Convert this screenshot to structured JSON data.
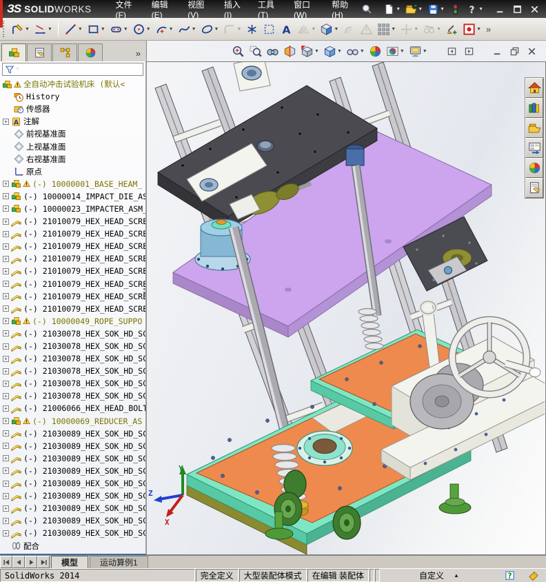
{
  "titlebar": {
    "logo": {
      "mark": "ЗS",
      "bold": "SOLID",
      "light": "WORKS"
    },
    "menus": [
      "文件(F)",
      "编辑(E)",
      "视图(V)",
      "插入(I)",
      "工具(T)",
      "窗口(W)",
      "帮助(H)"
    ],
    "search_icon": "search",
    "quick_access": [
      {
        "i": "new-document",
        "dd": 1
      },
      {
        "i": "open-folder",
        "dd": 1
      },
      {
        "i": "save",
        "dd": 1
      },
      {
        "i": "rebuild-lights"
      },
      {
        "i": "help",
        "dd": 1
      }
    ],
    "window_buttons": [
      {
        "i": "win-minimize"
      },
      {
        "i": "win-maximize"
      },
      {
        "i": "win-close"
      }
    ]
  },
  "sketch_toolbar": [
    {
      "i": "sketch",
      "dd": 1
    },
    {
      "i": "smart-dimension",
      "dd": 1
    },
    {
      "sep": 1
    },
    {
      "i": "line",
      "dd": 1
    },
    {
      "i": "rectangle",
      "dd": 1
    },
    {
      "i": "slot",
      "dd": 1
    },
    {
      "i": "circle",
      "dd": 1
    },
    {
      "i": "arc",
      "dd": 1
    },
    {
      "i": "spline",
      "dd": 1
    },
    {
      "i": "ellipse",
      "dd": 1
    },
    {
      "i": "fillet",
      "dd": 1,
      "dis": 1
    },
    {
      "i": "point"
    },
    {
      "i": "select-box"
    },
    {
      "i": "text-tool"
    },
    {
      "i": "mirror-entities",
      "dd": 1,
      "dis": 1
    },
    {
      "i": "convert-entities",
      "dd": 1
    },
    {
      "i": "offset-entities",
      "dis": 1
    },
    {
      "i": "sketch-warning",
      "dis": 1
    },
    {
      "i": "linear-pattern",
      "dd": 1
    },
    {
      "i": "move-entities",
      "dd": 1,
      "dis": 1
    },
    {
      "i": "display-relations",
      "dd": 1,
      "dis": 1
    },
    {
      "i": "quick-snaps"
    },
    {
      "i": "no-external-refs",
      "dd": 1
    },
    {
      "chev": 1
    }
  ],
  "manager_tabs": [
    {
      "i": "featuremanager",
      "active": 1
    },
    {
      "i": "propertymanager"
    },
    {
      "i": "configurationmanager"
    },
    {
      "i": "displaymanager"
    },
    {
      "chev": 1
    }
  ],
  "headsup_toolbar": [
    {
      "i": "zoom-fit"
    },
    {
      "i": "zoom-area"
    },
    {
      "i": "previous-view"
    },
    {
      "i": "section-view"
    },
    {
      "i": "view-orientation",
      "dd": 1
    },
    {
      "i": "display-style",
      "dd": 1
    },
    {
      "i": "hide-show-items",
      "dd": 1
    },
    {
      "i": "edit-appearance"
    },
    {
      "i": "apply-scene",
      "dd": 1
    },
    {
      "i": "view-settings",
      "dd": 1
    }
  ],
  "child_window_buttons": [
    {
      "i": "pane-left"
    },
    {
      "i": "pane-right"
    },
    {
      "gap": 1
    },
    {
      "i": "win-minimize"
    },
    {
      "i": "win-restore"
    },
    {
      "i": "win-close"
    }
  ],
  "feature_tree": {
    "filter_icon": "funnel",
    "rows": [
      {
        "icon": "assembly",
        "warn": true,
        "olive": true,
        "label": "全自动冲击试验机床 (默认<",
        "indent": 0
      },
      {
        "icon": "history",
        "label": "History",
        "indent": 1
      },
      {
        "icon": "sensors",
        "label": "传感器",
        "indent": 1
      },
      {
        "icon": "annotations",
        "label": "注解",
        "indent": 1,
        "plus": true
      },
      {
        "icon": "plane",
        "label": "前视基准面",
        "indent": 1
      },
      {
        "icon": "plane",
        "label": "上视基准面",
        "indent": 1
      },
      {
        "icon": "plane",
        "label": "右视基准面",
        "indent": 1
      },
      {
        "icon": "origin",
        "label": "原点",
        "indent": 1
      },
      {
        "icon": "assembly",
        "warn": true,
        "olive": true,
        "plus": true,
        "label": "(-) 10000001_BASE_HEAM_"
      },
      {
        "icon": "assembly",
        "plus": true,
        "label": "(-) 10000014_IMPACT_DIE_AS"
      },
      {
        "icon": "assembly",
        "plus": true,
        "label": "(-) 10000023_IMPACTER_ASM_"
      },
      {
        "icon": "part",
        "plus": true,
        "label": "(-) 21010079_HEX_HEAD_SCRE"
      },
      {
        "icon": "part",
        "plus": true,
        "label": "(-) 21010079_HEX_HEAD_SCRE"
      },
      {
        "icon": "part",
        "plus": true,
        "label": "(-) 21010079_HEX_HEAD_SCRE"
      },
      {
        "icon": "part",
        "plus": true,
        "label": "(-) 21010079_HEX_HEAD_SCRE"
      },
      {
        "icon": "part",
        "plus": true,
        "label": "(-) 21010079_HEX_HEAD_SCRE"
      },
      {
        "icon": "part",
        "plus": true,
        "label": "(-) 21010079_HEX_HEAD_SCRE"
      },
      {
        "icon": "part",
        "plus": true,
        "label": "(-) 21010079_HEX_HEAD_SCRE"
      },
      {
        "icon": "part",
        "plus": true,
        "label": "(-) 21010079_HEX_HEAD_SCRE"
      },
      {
        "icon": "assembly",
        "warn": true,
        "olive": true,
        "plus": true,
        "label": "(-) 10000049_ROPE_SUPPO"
      },
      {
        "icon": "part",
        "plus": true,
        "label": "(-) 21030078_HEX_SOK_HD_SC"
      },
      {
        "icon": "part",
        "plus": true,
        "label": "(-) 21030078_HEX_SOK_HD_SC"
      },
      {
        "icon": "part",
        "plus": true,
        "label": "(-) 21030078_HEX_SOK_HD_SC"
      },
      {
        "icon": "part",
        "plus": true,
        "label": "(-) 21030078_HEX_SOK_HD_SC"
      },
      {
        "icon": "part",
        "plus": true,
        "label": "(-) 21030078_HEX_SOK_HD_SC"
      },
      {
        "icon": "part",
        "plus": true,
        "label": "(-) 21030078_HEX_SOK_HD_SC"
      },
      {
        "icon": "part",
        "plus": true,
        "label": "(-) 21006066_HEX_HEAD_BOLT"
      },
      {
        "icon": "assembly",
        "warn": true,
        "olive": true,
        "plus": true,
        "label": "(-) 10000069_REDUCER_AS"
      },
      {
        "icon": "part",
        "plus": true,
        "label": "(-) 21030089_HEX_SOK_HD_SC"
      },
      {
        "icon": "part",
        "plus": true,
        "label": "(-) 21030089_HEX_SOK_HD_SC"
      },
      {
        "icon": "part",
        "plus": true,
        "label": "(-) 21030089_HEX_SOK_HD_SC"
      },
      {
        "icon": "part",
        "plus": true,
        "label": "(-) 21030089_HEX_SOK_HD_SC"
      },
      {
        "icon": "part",
        "plus": true,
        "label": "(-) 21030089_HEX_SOK_HD_SC"
      },
      {
        "icon": "part",
        "plus": true,
        "label": "(-) 21030089_HEX_SOK_HD_SC"
      },
      {
        "icon": "part",
        "plus": true,
        "label": "(-) 21030089_HEX_SOK_HD_SC"
      },
      {
        "icon": "part",
        "plus": true,
        "label": "(-) 21030089_HEX_SOK_HD_SC"
      },
      {
        "icon": "part",
        "plus": true,
        "label": "(-) 21030089_HEX_SOK_HD_SC"
      },
      {
        "icon": "mates",
        "label": "配合",
        "indent": 0
      }
    ]
  },
  "viewport": {
    "triad": {
      "x": "X",
      "y": "Y",
      "z": "Z"
    },
    "model_colors": {
      "top_plate": "#46464c",
      "carriage_plate": "#cca5ee",
      "base_plate_orange": "#ee8a4e",
      "base_plate_teal": "#7fe6c4",
      "frame_aluminum": "#cdcdd2",
      "feet_green": "#3f7d2e",
      "collar_gold": "#e6b23a"
    }
  },
  "task_pane": [
    {
      "i": "home"
    },
    {
      "i": "design-library"
    },
    {
      "i": "file-explorer"
    },
    {
      "i": "view-palette"
    },
    {
      "i": "appearances"
    },
    {
      "i": "custom-properties"
    }
  ],
  "doc_tabs": {
    "nav": [
      {
        "i": "nav-first"
      },
      {
        "i": "nav-prev"
      },
      {
        "i": "nav-next"
      },
      {
        "i": "nav-last"
      }
    ],
    "tabs": [
      {
        "label": "模型",
        "active": true
      },
      {
        "label": "运动算例1",
        "active": false
      }
    ]
  },
  "status_bar": {
    "left": "SolidWorks 2014",
    "define_state": "完全定义",
    "assembly_mode": "大型装配体模式",
    "edit_state": "在编辑 装配体",
    "custom_label": "自定义",
    "help_icon": "help-green",
    "tag_icon": "tag"
  }
}
